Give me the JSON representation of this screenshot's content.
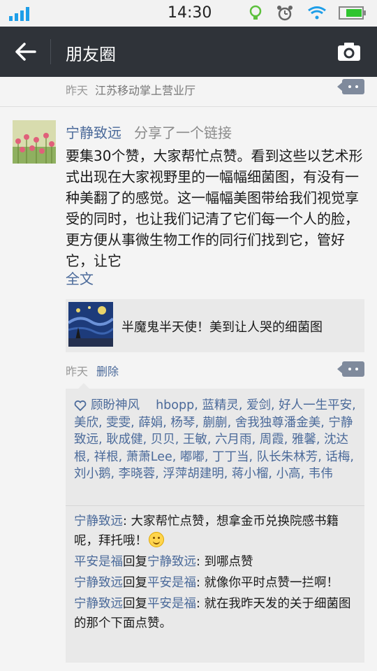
{
  "status_bar": {
    "time": "14:30"
  },
  "header": {
    "title": "朋友圈"
  },
  "previous_post": {
    "time": "昨天",
    "source": "江苏移动掌上营业厅"
  },
  "post": {
    "author": "宁静致远",
    "action": "分享了一个链接",
    "text": "要集30个赞，大家帮忙点赞。看到这些以艺术形式出现在大家视野里的一幅幅细菌图，有没有一种美翻了的感觉。这一幅幅美图带给我们视觉享受的同时，也让我们记清了它们每一个人的脸，更方便从事微生物工作的同行们找到它，管好它，让它",
    "full_text_label": "全文",
    "link_title": "半魔鬼半天使！美到让人哭的细菌图",
    "time": "昨天",
    "delete_label": "删除"
  },
  "likes": [
    "顾盼神风",
    "hbopp",
    "蓝精灵",
    "爱剑",
    "好人一生平安",
    "美欣",
    "雯雯",
    "薛娟",
    "杨琴",
    "蒯蒯",
    "舍我独尊潘金美",
    "宁静致远",
    "耿成健",
    "贝贝",
    "王敏",
    "六月雨",
    "周霞",
    "雅馨",
    "沈达根",
    "祥根",
    "萧萧Lee",
    "嘟嘟",
    "丁丁当",
    "队长朱林芳",
    "话梅",
    "刘小鹅",
    "李晓蓉",
    "浮萍胡建明",
    "蒋小榴",
    "小高",
    "韦伟"
  ],
  "comments": [
    {
      "from": "宁静致远",
      "to": "",
      "sep": ": ",
      "text": "大家帮忙点赞，想拿金币兑换院感书籍呢，拜托哦！",
      "emoji": true
    },
    {
      "from": "平安是福",
      "reply_word": "回复",
      "to": "宁静致远",
      "sep": ": ",
      "text": "到哪点赞"
    },
    {
      "from": "宁静致远",
      "reply_word": "回复",
      "to": "平安是福",
      "sep": ": ",
      "text": "就像你平时点赞一拦啊！"
    },
    {
      "from": "宁静致远",
      "reply_word": "回复",
      "to": "平安是福",
      "sep": ": ",
      "text": "就在我昨天发的关于细菌图的那个下面点赞。"
    }
  ],
  "colors": {
    "link": "#4b6a9a",
    "titlebar": "#2f3339",
    "status_green": "#2fc52f",
    "status_blue": "#1e9ee8"
  },
  "icons": [
    "signal-icon",
    "bulb-icon",
    "alarm-icon",
    "wifi-icon",
    "battery-icon",
    "back-arrow-icon",
    "camera-icon",
    "heart-icon",
    "comment-icon",
    "smile-emoji-icon"
  ]
}
